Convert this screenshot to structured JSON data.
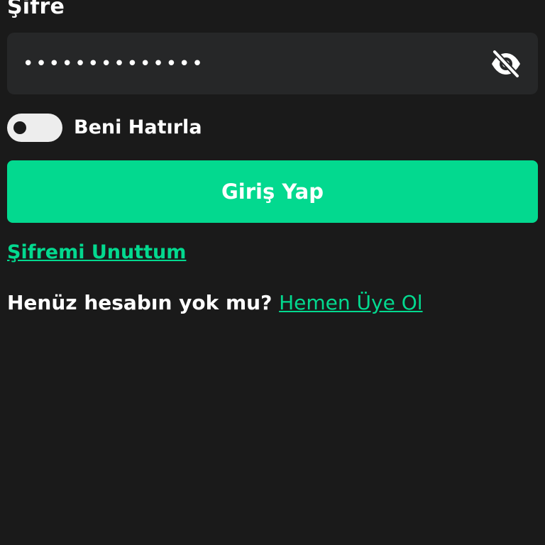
{
  "password": {
    "label": "Şifre",
    "value": "••••••••••••••",
    "visibility_icon": "eye-off-icon"
  },
  "remember_me": {
    "label": "Beni Hatırla",
    "enabled": false
  },
  "login_button": {
    "label": "Giriş Yap"
  },
  "forgot_password": {
    "label": "Şifremi Unuttum"
  },
  "signup": {
    "prompt": "Henüz hesabın yok mu?",
    "link": "Hemen Üye Ol"
  },
  "colors": {
    "background": "#1a1a1a",
    "field_background": "#262728",
    "accent": "#03d98f",
    "text": "#ffffff"
  }
}
